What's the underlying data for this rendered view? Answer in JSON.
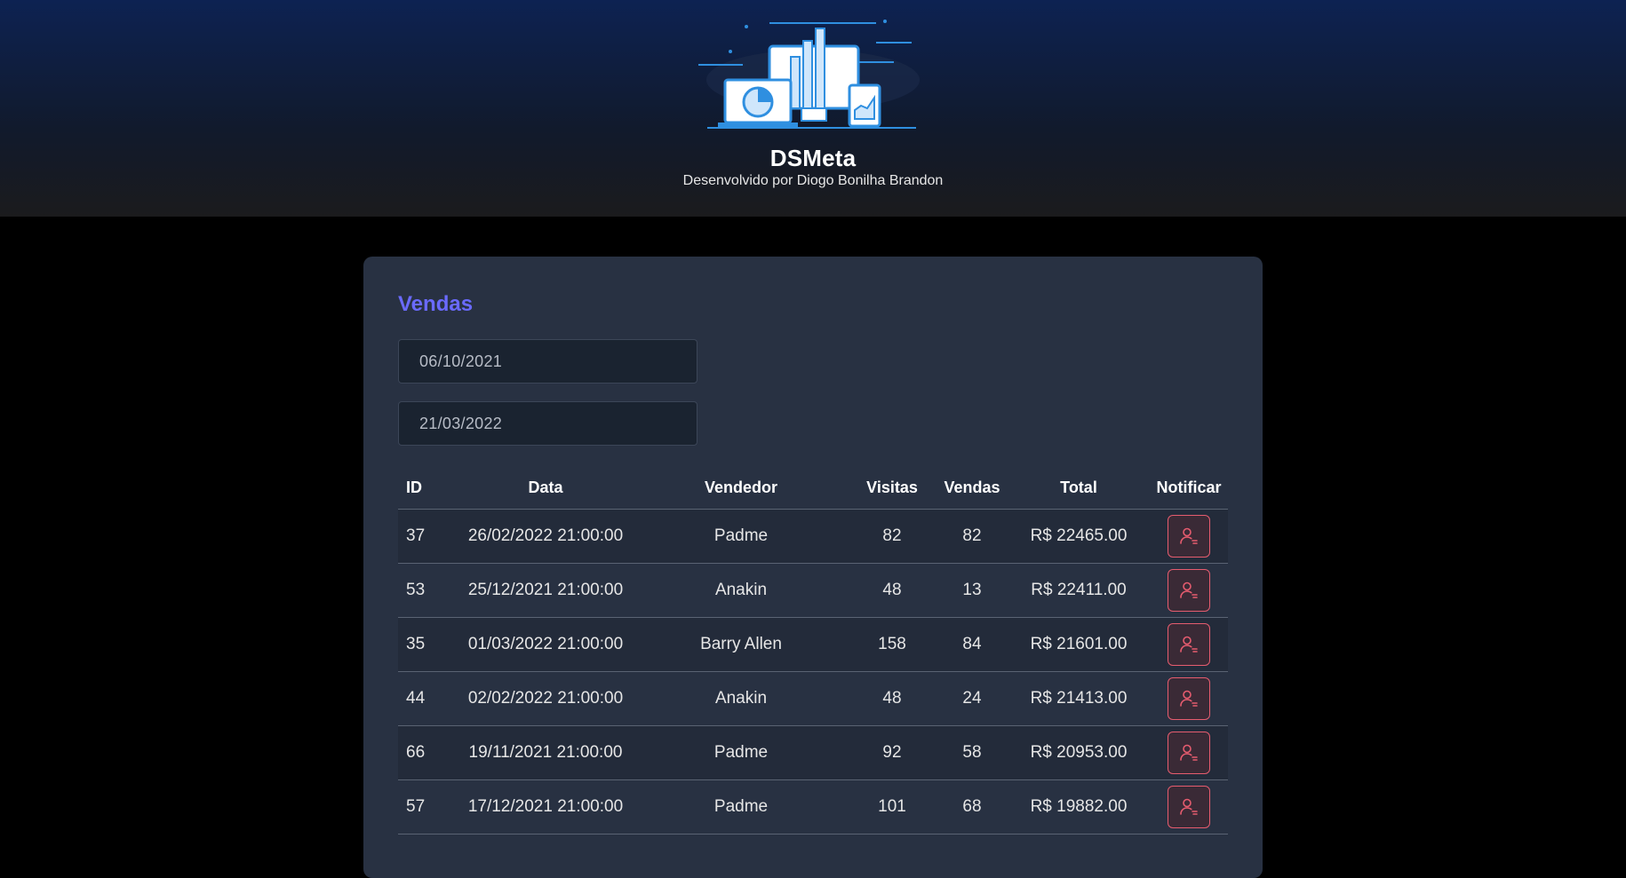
{
  "header": {
    "title": "DSMeta",
    "subtitle": "Desenvolvido por Diogo Bonilha Brandon",
    "logo_icon": "analytics-devices-illustration"
  },
  "card": {
    "title": "Vendas",
    "min_date": "06/10/2021",
    "max_date": "21/03/2022"
  },
  "table": {
    "columns": [
      "ID",
      "Data",
      "Vendedor",
      "Visitas",
      "Vendas",
      "Total",
      "Notificar"
    ],
    "rows": [
      {
        "id": "37",
        "date": "26/02/2022 21:00:00",
        "seller": "Padme",
        "visits": "82",
        "deals": "82",
        "total": "R$ 22465.00"
      },
      {
        "id": "53",
        "date": "25/12/2021 21:00:00",
        "seller": "Anakin",
        "visits": "48",
        "deals": "13",
        "total": "R$ 22411.00"
      },
      {
        "id": "35",
        "date": "01/03/2022 21:00:00",
        "seller": "Barry Allen",
        "visits": "158",
        "deals": "84",
        "total": "R$ 21601.00"
      },
      {
        "id": "44",
        "date": "02/02/2022 21:00:00",
        "seller": "Anakin",
        "visits": "48",
        "deals": "24",
        "total": "R$ 21413.00"
      },
      {
        "id": "66",
        "date": "19/11/2021 21:00:00",
        "seller": "Padme",
        "visits": "92",
        "deals": "58",
        "total": "R$ 20953.00"
      },
      {
        "id": "57",
        "date": "17/12/2021 21:00:00",
        "seller": "Padme",
        "visits": "101",
        "deals": "68",
        "total": "R$ 19882.00"
      }
    ]
  },
  "colors": {
    "accent": "#6a6aff",
    "card_bg": "#283142",
    "notify_border": "#e65c6f"
  }
}
